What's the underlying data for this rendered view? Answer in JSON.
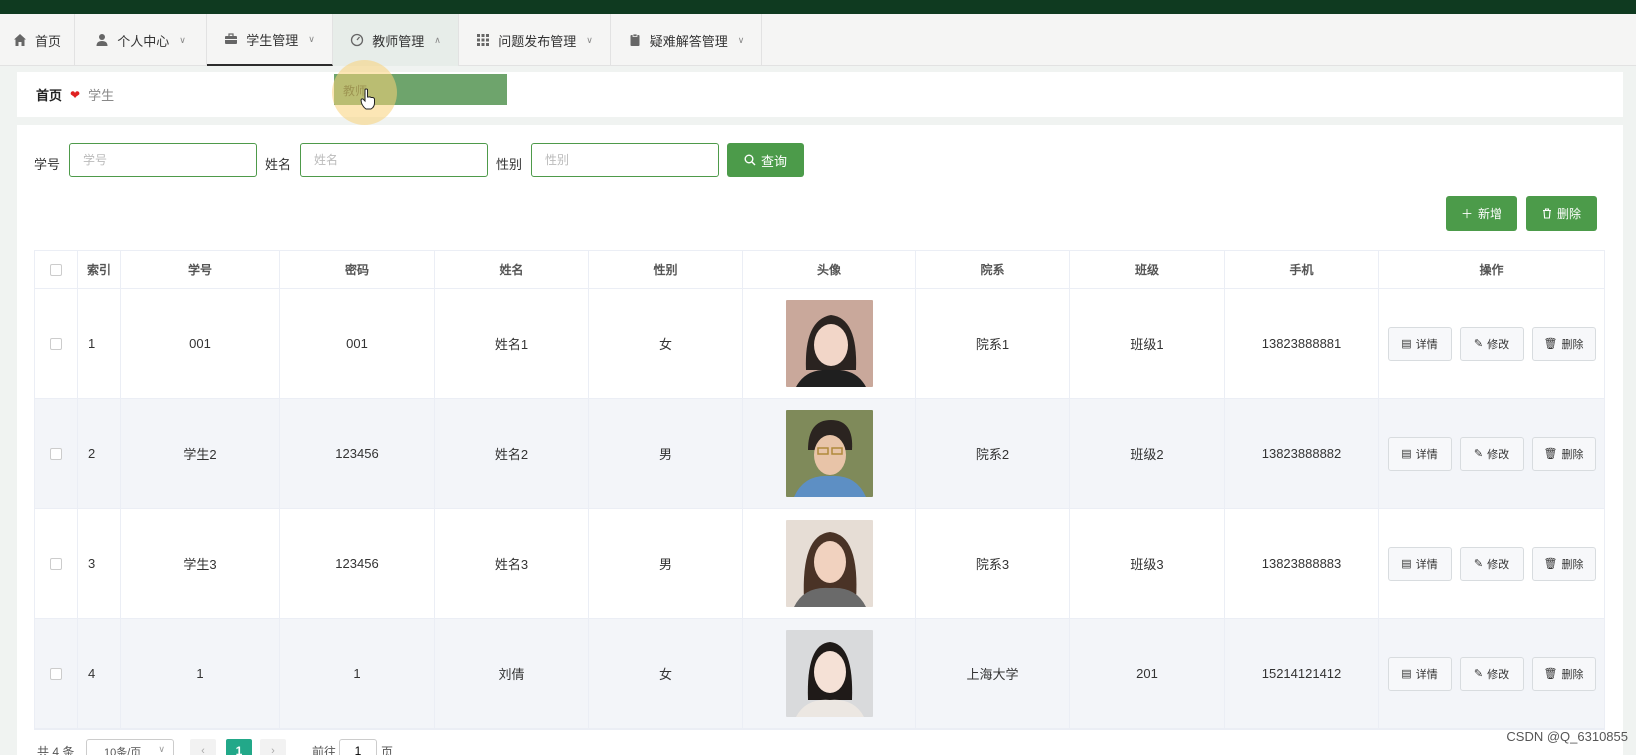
{
  "colors": {
    "topbar": "#0f3a20",
    "accent": "#4c9b4a",
    "dropdown": "#6ea46c",
    "pager_active": "#22a889"
  },
  "nav": {
    "items": [
      {
        "label": "首页",
        "icon": "home-icon",
        "dropdown": false
      },
      {
        "label": "个人中心",
        "icon": "user-icon",
        "dropdown": true
      },
      {
        "label": "学生管理",
        "icon": "briefcase-icon",
        "dropdown": true
      },
      {
        "label": "教师管理",
        "icon": "gauge-icon",
        "dropdown": true
      },
      {
        "label": "问题发布管理",
        "icon": "grid-icon",
        "dropdown": true
      },
      {
        "label": "疑难解答管理",
        "icon": "clipboard-icon",
        "dropdown": true
      }
    ],
    "open_menu": {
      "items": [
        "教师"
      ]
    }
  },
  "breadcrumb": {
    "home": "首页",
    "current": "学生"
  },
  "search": {
    "fields": [
      {
        "label": "学号",
        "placeholder": "学号",
        "value": ""
      },
      {
        "label": "姓名",
        "placeholder": "姓名",
        "value": ""
      },
      {
        "label": "性别",
        "placeholder": "性别",
        "value": ""
      }
    ],
    "button_label": "查询"
  },
  "actions": {
    "add_label": "新增",
    "delete_label": "删除"
  },
  "table": {
    "columns": [
      "索引",
      "学号",
      "密码",
      "姓名",
      "性别",
      "头像",
      "院系",
      "班级",
      "手机",
      "操作"
    ],
    "rows": [
      {
        "index": "1",
        "student_no": "001",
        "password": "001",
        "name": "姓名1",
        "gender": "女",
        "avatar": "portrait-photo",
        "dept": "院系1",
        "class": "班级1",
        "phone": "13823888881"
      },
      {
        "index": "2",
        "student_no": "学生2",
        "password": "123456",
        "name": "姓名2",
        "gender": "男",
        "avatar": "portrait-photo",
        "dept": "院系2",
        "class": "班级2",
        "phone": "13823888882"
      },
      {
        "index": "3",
        "student_no": "学生3",
        "password": "123456",
        "name": "姓名3",
        "gender": "男",
        "avatar": "portrait-photo",
        "dept": "院系3",
        "class": "班级3",
        "phone": "13823888883"
      },
      {
        "index": "4",
        "student_no": "1",
        "password": "1",
        "name": "刘倩",
        "gender": "女",
        "avatar": "portrait-photo",
        "dept": "上海大学",
        "class": "201",
        "phone": "15214121412"
      }
    ],
    "row_actions": {
      "detail": "详情",
      "edit": "修改",
      "delete": "删除"
    }
  },
  "pagination": {
    "total_text": "共 4 条",
    "page_size": "10条/页",
    "current_page": "1",
    "goto_prefix": "前往",
    "goto_value": "1",
    "goto_suffix": "页"
  },
  "watermark": "CSDN @Q_6310855"
}
